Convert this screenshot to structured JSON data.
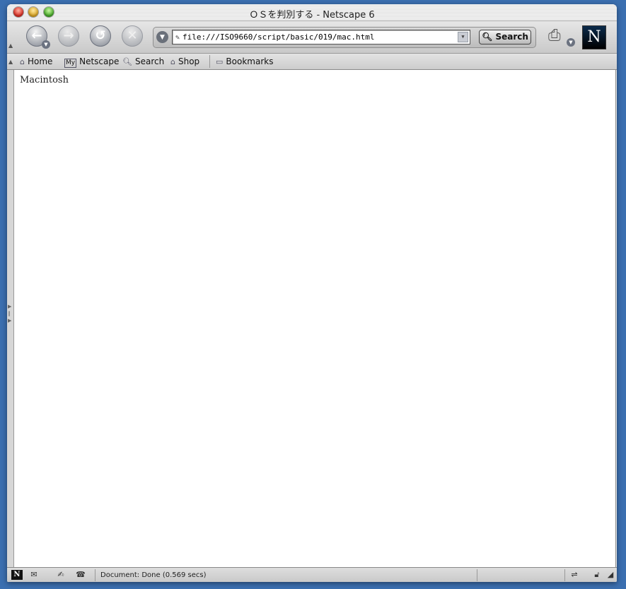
{
  "window": {
    "title": "ＯＳを判別する - Netscape 6"
  },
  "navbar": {
    "back_icon": "arrow-left",
    "forward_icon": "arrow-right",
    "reload_icon": "reload",
    "stop_icon": "close-x",
    "url": "file:///ISO9660/script/basic/019/mac.html",
    "search_label": "Search"
  },
  "personal_toolbar": {
    "items": [
      {
        "label": "Home",
        "icon": "home-icon"
      },
      {
        "label": "Netscape",
        "icon": "my-netscape-icon",
        "badge": "My"
      },
      {
        "label": "Search",
        "icon": "magnifier-icon"
      },
      {
        "label": "Shop",
        "icon": "shop-icon"
      },
      {
        "label": "Bookmarks",
        "icon": "folder-icon"
      }
    ]
  },
  "logo": {
    "letter": "N"
  },
  "page": {
    "text": "Macintosh"
  },
  "statusbar": {
    "text": "Document: Done (0.569 secs)",
    "n_badge": "N"
  },
  "colors": {
    "desktop": "#3b6fb0",
    "chrome": "#d4d4d4"
  }
}
